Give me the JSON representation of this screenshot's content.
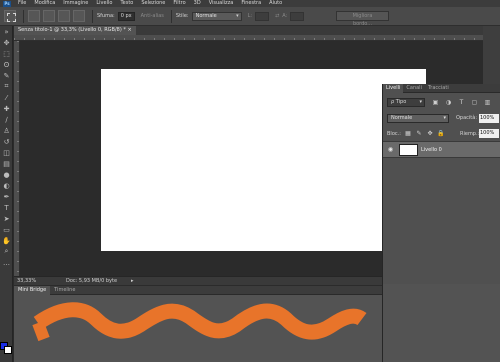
{
  "app": {
    "logo": "Ps",
    "menu": [
      "File",
      "Modifica",
      "Immagine",
      "Livello",
      "Testo",
      "Selezione",
      "Filtro",
      "3D",
      "Visualizza",
      "Finestra",
      "Aiuto"
    ]
  },
  "options": {
    "sfuma_label": "Sfuma:",
    "sfuma_value": "0 px",
    "antialias_label": "Anti-alias",
    "stile_label": "Stile:",
    "stile_value": "Normale",
    "l_label": "L:",
    "a_label": "A:",
    "refine_button": "Migliora bordo..."
  },
  "document": {
    "tab_title": "Senza titolo-1 @ 33,3% (Livello 0, RGB/8) *"
  },
  "status": {
    "zoom": "33,33%",
    "doc_info": "Doc: 5,93 MB/0 byte",
    "arrow": "▸"
  },
  "layers_panel": {
    "tabs": [
      "Livelli",
      "Canali",
      "Tracciati"
    ],
    "active_tab": "Livelli",
    "kind_filter": "ρ Tipo",
    "blend_mode": "Normale",
    "opacity_label": "Opacità:",
    "opacity_value": "100%",
    "lock_label": "Bloc.:",
    "fill_label": "Riemp.:",
    "fill_value": "100%",
    "layers": [
      {
        "name": "Livello 0",
        "visible": true
      }
    ]
  },
  "bottom_panel": {
    "tabs": [
      "Mini Bridge",
      "Timeline"
    ],
    "active_tab": "Mini Bridge",
    "brush_color": "#e8742a"
  },
  "colors": {
    "foreground": "#1a2ee6",
    "background": "#ffffff"
  },
  "tools": [
    "move-icon",
    "marquee-icon",
    "lasso-icon",
    "quick-select-icon",
    "crop-icon",
    "eyedropper-icon",
    "healing-icon",
    "brush-icon",
    "clone-stamp-icon",
    "history-brush-icon",
    "eraser-icon",
    "gradient-icon",
    "blur-icon",
    "dodge-icon",
    "pen-icon",
    "type-icon",
    "path-select-icon",
    "shape-icon",
    "hand-icon",
    "zoom-icon"
  ]
}
